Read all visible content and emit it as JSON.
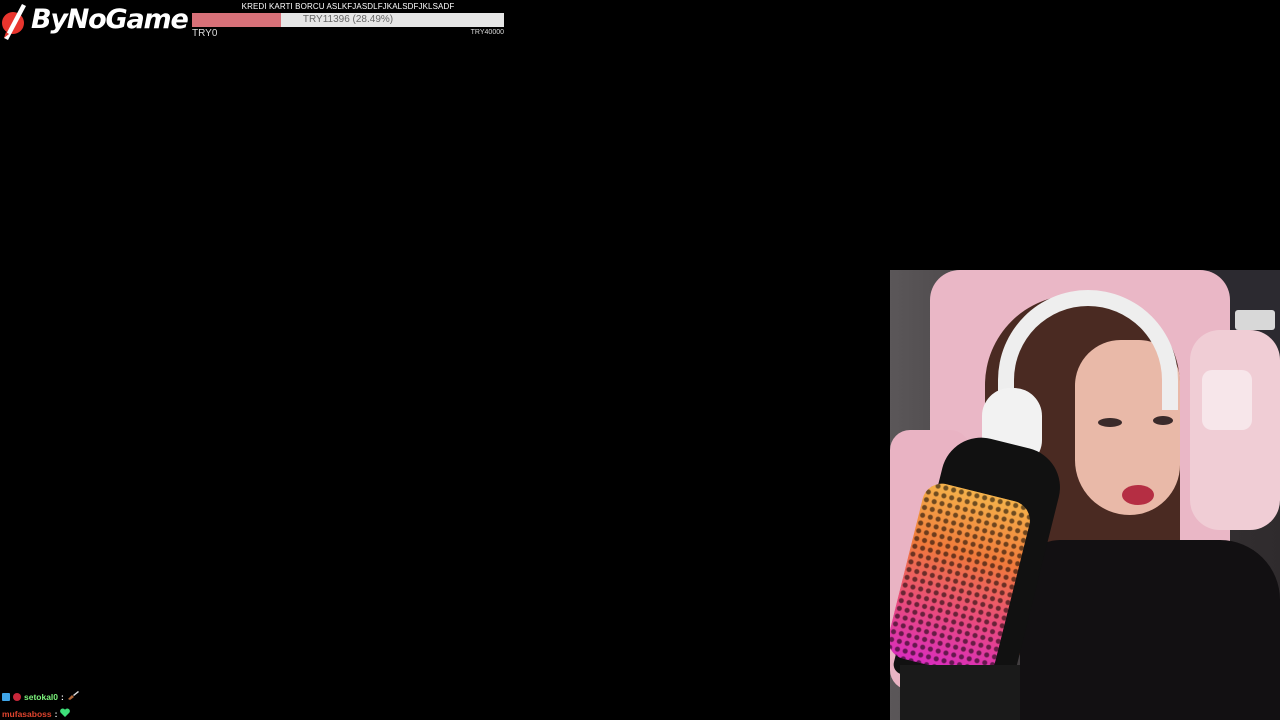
{
  "overlay": {
    "logo_text": "ByNoGame",
    "logo_icon": "pencil-slash-icon"
  },
  "goal": {
    "title": "KREDI KARTI BORCU ASLKFJASDLFJKALSDFJKLSADF",
    "current_label": "TRY11396 (28.49%)",
    "progress_fraction": 0.2849,
    "min_label": "TRY0",
    "max_label": "TRY40000",
    "fill_color": "#d77078",
    "track_color": "#e6e6e6"
  },
  "webcam": {
    "description_icon": "webcam-feed"
  },
  "chat": {
    "messages": [
      {
        "user": "setokal0",
        "separator": ":",
        "emote": "guitar-emote",
        "name_color": "#7cf57c"
      },
      {
        "user": "mufasaboss",
        "separator": ":",
        "emote": "green-heart-emote",
        "name_color": "#e0442e"
      }
    ]
  }
}
